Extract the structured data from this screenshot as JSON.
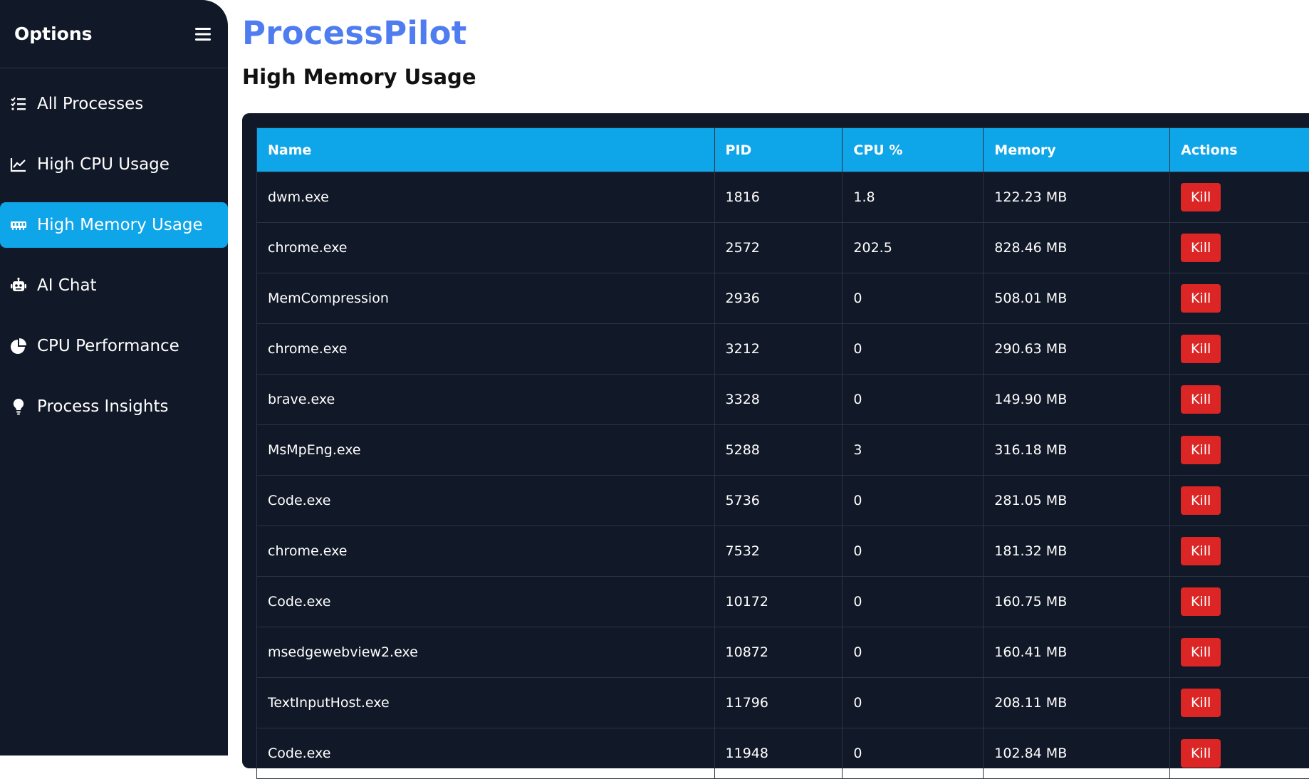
{
  "sidebar": {
    "title": "Options",
    "items": [
      {
        "label": "All Processes",
        "icon": "list-check-icon",
        "active": false
      },
      {
        "label": "High CPU Usage",
        "icon": "chart-line-icon",
        "active": false
      },
      {
        "label": "High Memory Usage",
        "icon": "memory-icon",
        "active": true
      },
      {
        "label": "AI Chat",
        "icon": "robot-icon",
        "active": false
      },
      {
        "label": "CPU Performance",
        "icon": "pie-chart-icon",
        "active": false
      },
      {
        "label": "Process Insights",
        "icon": "lightbulb-icon",
        "active": false
      }
    ]
  },
  "header": {
    "brand": "ProcessPilot",
    "page_title": "High Memory Usage"
  },
  "table": {
    "columns": [
      "Name",
      "PID",
      "CPU %",
      "Memory",
      "Actions"
    ],
    "kill_label": "Kill",
    "rows": [
      {
        "name": "dwm.exe",
        "pid": "1816",
        "cpu": "1.8",
        "memory": "122.23 MB"
      },
      {
        "name": "chrome.exe",
        "pid": "2572",
        "cpu": "202.5",
        "memory": "828.46 MB"
      },
      {
        "name": "MemCompression",
        "pid": "2936",
        "cpu": "0",
        "memory": "508.01 MB"
      },
      {
        "name": "chrome.exe",
        "pid": "3212",
        "cpu": "0",
        "memory": "290.63 MB"
      },
      {
        "name": "brave.exe",
        "pid": "3328",
        "cpu": "0",
        "memory": "149.90 MB"
      },
      {
        "name": "MsMpEng.exe",
        "pid": "5288",
        "cpu": "3",
        "memory": "316.18 MB"
      },
      {
        "name": "Code.exe",
        "pid": "5736",
        "cpu": "0",
        "memory": "281.05 MB"
      },
      {
        "name": "chrome.exe",
        "pid": "7532",
        "cpu": "0",
        "memory": "181.32 MB"
      },
      {
        "name": "Code.exe",
        "pid": "10172",
        "cpu": "0",
        "memory": "160.75 MB"
      },
      {
        "name": "msedgewebview2.exe",
        "pid": "10872",
        "cpu": "0",
        "memory": "160.41 MB"
      },
      {
        "name": "TextInputHost.exe",
        "pid": "11796",
        "cpu": "0",
        "memory": "208.11 MB"
      },
      {
        "name": "Code.exe",
        "pid": "11948",
        "cpu": "0",
        "memory": "102.84 MB"
      }
    ]
  },
  "colors": {
    "sidebar_bg": "#111827",
    "accent": "#0ea5e9",
    "brand": "#4f7df0",
    "danger": "#dc2626"
  }
}
